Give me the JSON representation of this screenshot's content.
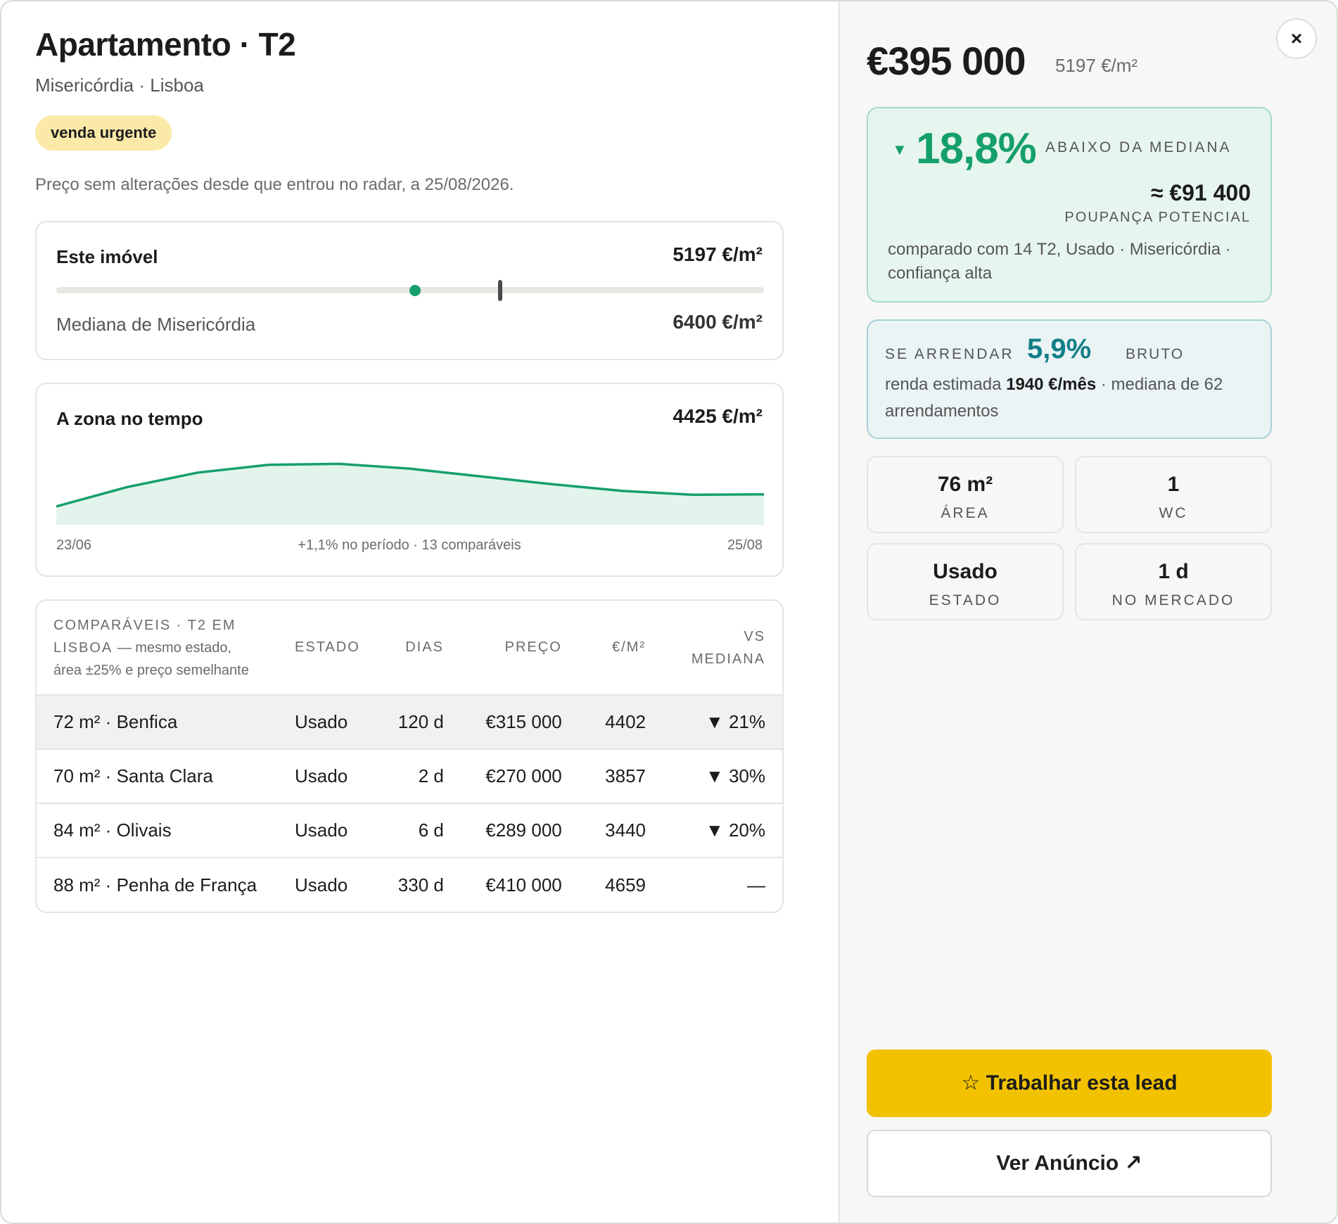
{
  "header": {
    "title": "Apartamento · T2",
    "subtitle": "Misericórdia · Lisboa",
    "badge": "venda urgente",
    "price_note": "Preço sem alterações desde que entrou no radar, a 25/08/2026."
  },
  "price_card": {
    "this_label": "Este imóvel",
    "this_value": "5197 €/m²",
    "median_label": "Mediana de Misericórdia",
    "median_value": "6400 €/m²"
  },
  "zone_card": {
    "title": "A zona no tempo",
    "value": "4425 €/m²",
    "x_start": "23/06",
    "x_end": "25/08",
    "caption": "+1,1% no período · 13 comparáveis"
  },
  "chart_data": {
    "type": "area",
    "title": "A zona no tempo",
    "x_start": "23/06",
    "x_end": "25/08",
    "values": [
      4040,
      4240,
      4390,
      4470,
      4480,
      4430,
      4350,
      4270,
      4200,
      4160,
      4165
    ],
    "ylim": [
      3850,
      4650
    ],
    "color": "#15a06a",
    "fill": "#e3f4ec",
    "grid": false
  },
  "comparables": {
    "header_title": "Comparáveis · T2 em Lisboa",
    "header_note": "— mesmo estado, área ±25% e preço semelhante",
    "columns": [
      "Estado",
      "Dias",
      "Preço",
      "€/m²",
      "vs mediana"
    ],
    "rows": [
      {
        "name": "72 m² · Benfica",
        "estado": "Usado",
        "dias": "120 d",
        "preco": "€315 000",
        "ppm": "4402",
        "vs": "▼ 21%"
      },
      {
        "name": "70 m² · Santa Clara",
        "estado": "Usado",
        "dias": "2 d",
        "preco": "€270 000",
        "ppm": "3857",
        "vs": "▼ 30%"
      },
      {
        "name": "84 m² · Olivais",
        "estado": "Usado",
        "dias": "6 d",
        "preco": "€289 000",
        "ppm": "3440",
        "vs": "▼ 20%"
      },
      {
        "name": "88 m² · Penha de França",
        "estado": "Usado",
        "dias": "330 d",
        "preco": "€410 000",
        "ppm": "4659",
        "vs": "—"
      }
    ]
  },
  "summary": {
    "close_icon": "×",
    "price": "€395 000",
    "price_per_m2": "5197 €/m²",
    "discount_pct": "18,8%",
    "discount_label": "abaixo da mediana",
    "discount_arrow": "▼",
    "savings": "≈ €91 400",
    "savings_label": "poupança potencial",
    "compared_text": "comparado com 14 T2, Usado · Misericórdia · confiança alta",
    "rent_label": "se arrendar",
    "rent_pct": "5,9%",
    "rent_gross": "bruto",
    "rent_text_pre": "renda estimada ",
    "rent_amount": "1940 €/mês",
    "rent_text_post": " · mediana de 62 arrendamentos",
    "stats": [
      {
        "value": "76 m²",
        "label": "Área"
      },
      {
        "value": "1",
        "label": "WC"
      },
      {
        "value": "Usado",
        "label": "Estado"
      },
      {
        "value": "1 d",
        "label": "No mercado"
      }
    ],
    "primary_button": "☆ Trabalhar esta lead",
    "secondary_button": "Ver Anúncio ↗"
  },
  "colors": {
    "accent_green": "#15a06a",
    "accent_teal": "#137f87",
    "primary_button": "#f2c200",
    "badge_bg": "#fbe9a8"
  }
}
